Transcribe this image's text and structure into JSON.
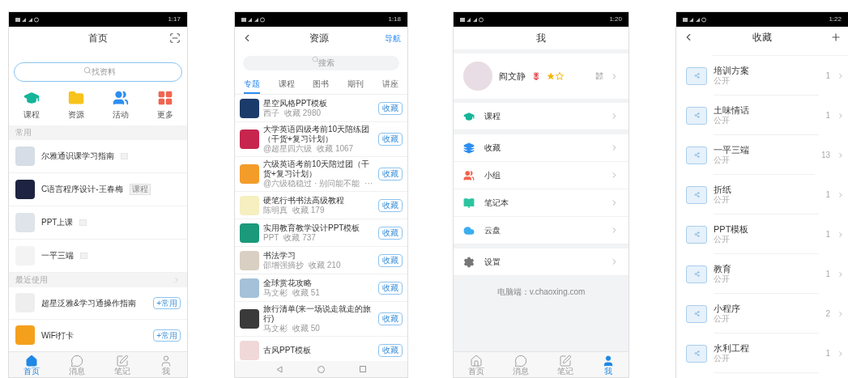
{
  "home": {
    "status_time": "1:17",
    "title": "首页",
    "search": {
      "placeholder": "找资料"
    },
    "shortcuts": [
      {
        "label": "课程"
      },
      {
        "label": "资源"
      },
      {
        "label": "活动"
      },
      {
        "label": "更多"
      }
    ],
    "frequent_header": "常用",
    "frequent": [
      {
        "title": "尔雅通识课学习指南"
      },
      {
        "title": "C语言程序设计-王春梅",
        "tag": "课程"
      },
      {
        "title": "PPT上课"
      },
      {
        "title": "一平三端"
      }
    ],
    "recent_header": "最近使用",
    "recent": [
      {
        "title": "超星泛雅&学习通操作指南",
        "action": "+常用"
      },
      {
        "title": "WiFi打卡",
        "action": "+常用"
      }
    ],
    "nav": [
      {
        "label": "首页",
        "selected": true
      },
      {
        "label": "消息",
        "selected": false
      },
      {
        "label": "笔记",
        "selected": false
      },
      {
        "label": "我",
        "selected": false
      }
    ]
  },
  "resources": {
    "status_time": "1:18",
    "title": "资源",
    "nav_link": "导航",
    "search": {
      "placeholder": "搜索"
    },
    "tabs": [
      {
        "label": "专题",
        "selected": true
      },
      {
        "label": "课程",
        "selected": false
      },
      {
        "label": "图书",
        "selected": false
      },
      {
        "label": "期刊",
        "selected": false
      },
      {
        "label": "讲座",
        "selected": false
      }
    ],
    "items": [
      {
        "title": "星空风格PPT模板",
        "author": "西子",
        "count": "收藏 2980",
        "action": "收藏"
      },
      {
        "title": "大学英语四级考前10天陪练团（干货+复习计划）",
        "author": "@超星四六级",
        "count": "收藏 1067",
        "action": "收藏"
      },
      {
        "title": "六级英语考前10天陪过团（干货+复习计划）",
        "author": "@六级稳稳过 · 别问能不能",
        "count": "···",
        "action": "收藏"
      },
      {
        "title": "硬笔行书书法高级教程",
        "author": "陈明真",
        "count": "收藏 179",
        "action": "收藏"
      },
      {
        "title": "实用教育教学设计PPT模板",
        "author": "PPT",
        "count": "收藏 737",
        "action": "收藏"
      },
      {
        "title": "书法学习",
        "author": "邵增强摘抄",
        "count": "收藏 210",
        "action": "收藏"
      },
      {
        "title": "全球赏花攻略",
        "author": "马文彬",
        "count": "收藏 51",
        "action": "收藏"
      },
      {
        "title": "旅行清单(来一场说走就走的旅行)",
        "author": "马文彬",
        "count": "收藏 50",
        "action": "收藏"
      },
      {
        "title": "古风PPT模板",
        "action": "收藏"
      }
    ]
  },
  "me": {
    "status_time": "1:20",
    "title": "我",
    "profile": {
      "name": "阎文静"
    },
    "menu_groups": [
      [
        {
          "label": "课程"
        }
      ],
      [
        {
          "label": "收藏"
        },
        {
          "label": "小组"
        },
        {
          "label": "笔记本"
        },
        {
          "label": "云盘"
        }
      ],
      [
        {
          "label": "设置"
        }
      ]
    ],
    "footer": "电脑端：v.chaoxing.com",
    "nav": [
      {
        "label": "首页",
        "selected": false
      },
      {
        "label": "消息",
        "selected": false
      },
      {
        "label": "笔记",
        "selected": false
      },
      {
        "label": "我",
        "selected": true
      }
    ]
  },
  "favorites": {
    "status_time": "1:22",
    "title": "收藏",
    "folders": [
      {
        "name": "培训方案",
        "visibility": "公开",
        "count": "1"
      },
      {
        "name": "土味情话",
        "visibility": "公开",
        "count": "1"
      },
      {
        "name": "一平三端",
        "visibility": "公开",
        "count": "13"
      },
      {
        "name": "折纸",
        "visibility": "公开",
        "count": "1"
      },
      {
        "name": "PPT模板",
        "visibility": "公开",
        "count": "1"
      },
      {
        "name": "教育",
        "visibility": "公开",
        "count": "1"
      },
      {
        "name": "小程序",
        "visibility": "公开",
        "count": "2"
      },
      {
        "name": "水利工程",
        "visibility": "公开",
        "count": "1"
      }
    ]
  }
}
